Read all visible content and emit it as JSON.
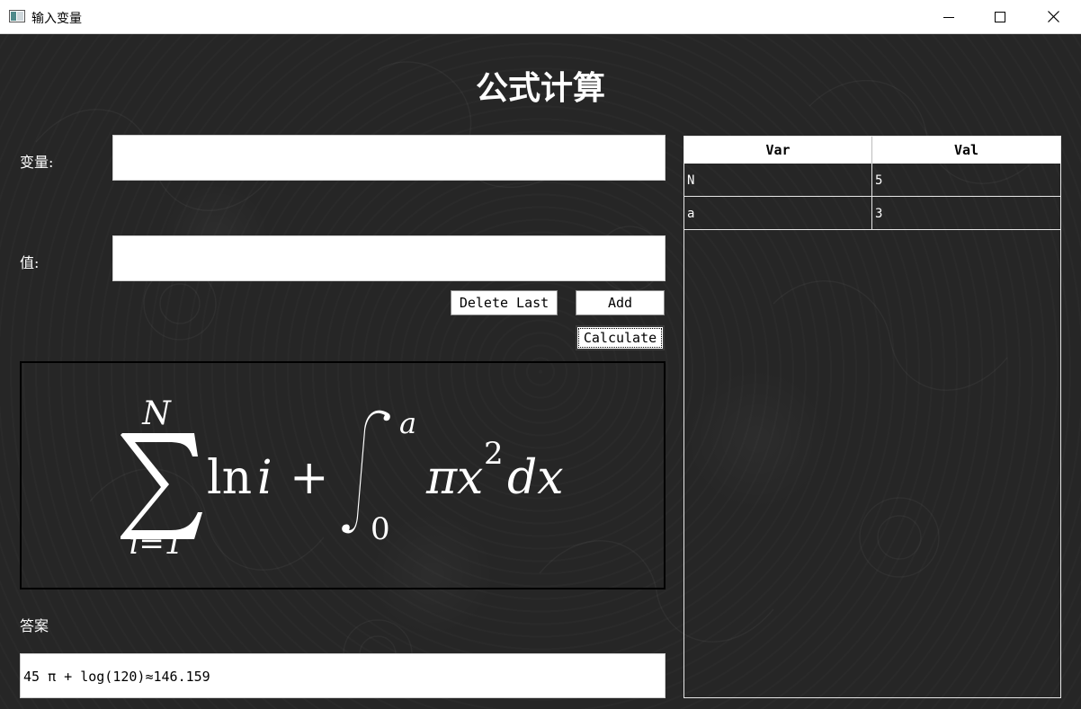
{
  "window": {
    "title": "输入变量",
    "controls": [
      "minimize-icon",
      "maximize-icon",
      "close-icon"
    ]
  },
  "page": {
    "heading": "公式计算"
  },
  "form": {
    "variable_label": "变量:",
    "variable_value": "",
    "value_label": "值:",
    "value_value": "",
    "delete_last_label": "Delete Last",
    "add_label": "Add",
    "calculate_label": "Calculate"
  },
  "formula": {
    "latex": "\\sum_{i=1}^{N} \\ln i + \\int_0^a \\pi x^2 dx",
    "sum_upper": "N",
    "sum_lower": "i=1",
    "ln_term": "ln",
    "i_term": "i",
    "plus": "+",
    "int_upper": "a",
    "int_lower": "0",
    "pi": "π",
    "x": "x",
    "exp": "2",
    "dx": "dx"
  },
  "answer": {
    "label": "答案",
    "value": "45 π + log(120)≈146.159"
  },
  "table": {
    "headers": [
      "Var",
      "Val"
    ],
    "rows": [
      {
        "var": "N",
        "val": "5"
      },
      {
        "var": "a",
        "val": "3"
      }
    ]
  },
  "colors": {
    "background": "#262626",
    "text": "#ffffff",
    "field": "#ffffff"
  }
}
